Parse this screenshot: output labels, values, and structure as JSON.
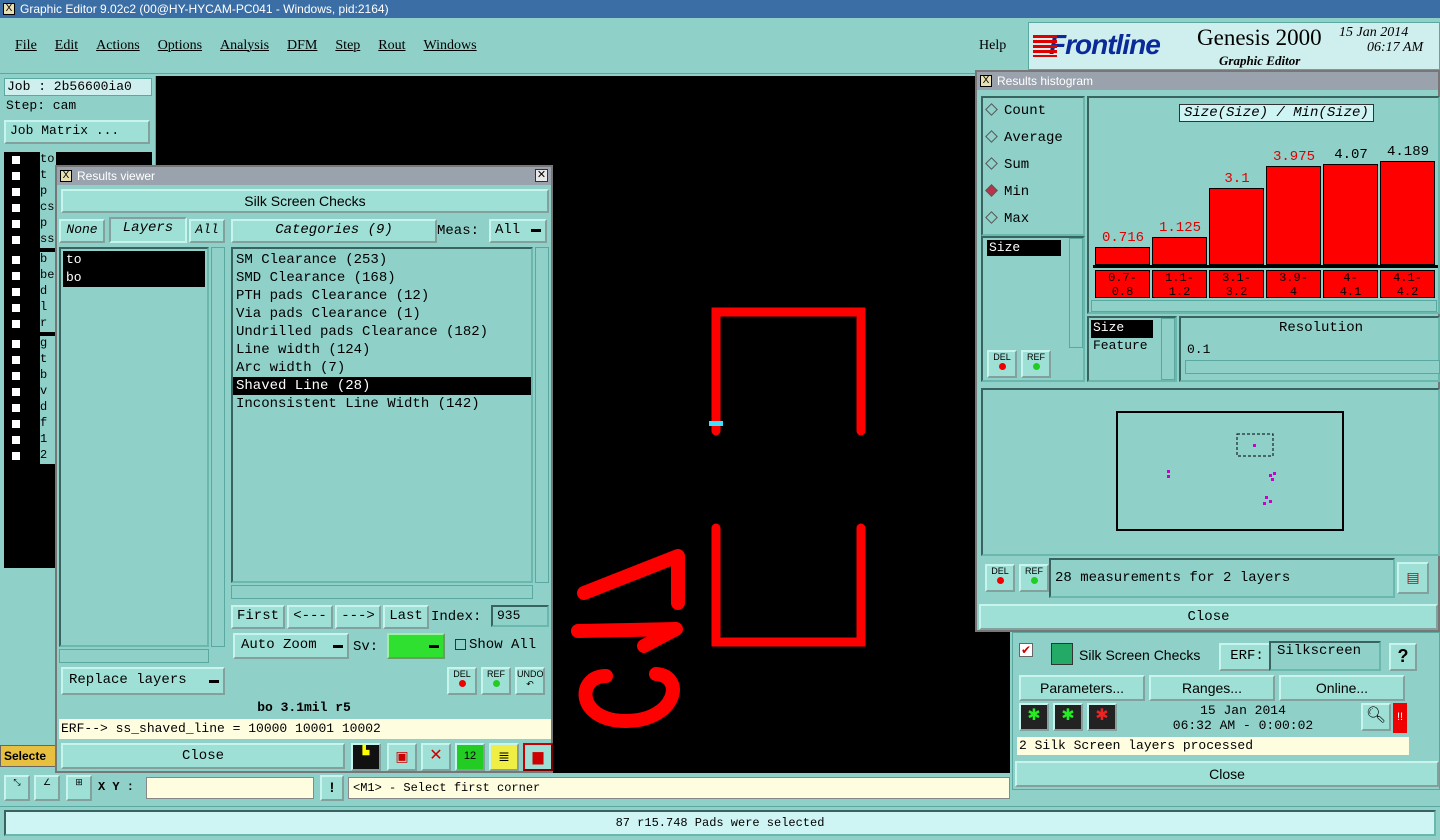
{
  "window": {
    "title": "Graphic Editor 9.02c2 (00@HY-HYCAM-PC041 - Windows, pid:2164)"
  },
  "menu": [
    "File",
    "Edit",
    "Actions",
    "Options",
    "Analysis",
    "DFM",
    "Step",
    "Rout",
    "Windows"
  ],
  "help": "Help",
  "brand": {
    "logo": "Frontline",
    "product": "Genesis 2000",
    "subtitle": "Graphic Editor",
    "date": "15 Jan 2014",
    "time": "06:17 AM"
  },
  "job": {
    "job": "Job : 2b56600ia0",
    "step": "Step: cam",
    "matrix": "Job Matrix ..."
  },
  "layers_left": [
    "to",
    "t",
    "p",
    "cs",
    "p",
    "ss",
    "b",
    "be",
    "d",
    "l",
    "r",
    "g",
    "t",
    "b",
    "v",
    "d",
    "f",
    "1",
    "2"
  ],
  "select_label": "Selecte",
  "xy": {
    "label": "X Y :",
    "prompt": "<M1> - Select first corner"
  },
  "status": "87 r15.748 Pads were selected",
  "results_viewer": {
    "title": "Results viewer",
    "header": "Silk Screen Checks",
    "none_btn": "None",
    "layers_btn": "Layers",
    "all_btn": "All",
    "layers": [
      "to",
      "bo"
    ],
    "categories_btn": "Categories (9)",
    "meas_label": "Meas:",
    "meas_value": "All",
    "categories": [
      "SM Clearance (253)",
      "SMD Clearance (168)",
      "PTH pads Clearance (12)",
      "Via pads Clearance (1)",
      "Undrilled pads Clearance (182)",
      "Line width (124)",
      "Arc width (7)",
      "Shaved Line (28)",
      "Inconsistent Line Width (142)"
    ],
    "selected_category": 7,
    "first": "First",
    "prev": "<---",
    "next": "--->",
    "last": "Last",
    "index_label": "Index:",
    "index_value": "935",
    "auto_zoom": "Auto Zoom",
    "sv_label": "Sv:",
    "show_all": "Show All",
    "replace_layers": "Replace layers",
    "del": "DEL",
    "ref": "REF",
    "undo": "UNDO",
    "info": "bo 3.1mil  r5",
    "erf": "ERF--> ss_shaved_line = 10000 10001 10002",
    "close": "Close"
  },
  "histogram": {
    "title": "Results histogram",
    "modes": [
      "Count",
      "Average",
      "Sum",
      "Min",
      "Max"
    ],
    "selected_mode": 3,
    "chart_title": "Size(Size) / Min(Size)",
    "list_item": "Size",
    "axis_items": [
      "Size",
      "Feature"
    ],
    "resolution_label": "Resolution",
    "resolution_value": "0.1",
    "del": "DEL",
    "ref": "REF",
    "measurements": "28 measurements for 2 layers",
    "close": "Close"
  },
  "chart_data": {
    "type": "bar",
    "title": "Size(Size) / Min(Size)",
    "categories": [
      "0.7-0.8",
      "1.1-1.2",
      "3.1-3.2",
      "3.9-4",
      "4-4.1",
      "4.1-4.2"
    ],
    "values": [
      0.716,
      1.125,
      3.1,
      3.975,
      4.07,
      4.189
    ],
    "value_labels": [
      "0.716",
      "1.125",
      "3.1",
      "3.975",
      "4.07",
      "4.189"
    ],
    "label_colors": [
      "#e00000",
      "#e00000",
      "#e00000",
      "#e00000",
      "#000000",
      "#000000"
    ],
    "bin_lines": [
      [
        "0.7-",
        "0.8"
      ],
      [
        "1.1-",
        "1.2"
      ],
      [
        "3.1-",
        "3.2"
      ],
      [
        "3.9-",
        "4"
      ],
      [
        "4-",
        "4.1"
      ],
      [
        "4.1-",
        "4.2"
      ]
    ],
    "ylim": [
      0,
      4.189
    ],
    "bar_color": "#ff0000"
  },
  "silk": {
    "title": "Silk Screen Checks",
    "erf_label": "ERF:",
    "erf_value": "Silkscreen",
    "help": "?",
    "parameters": "Parameters...",
    "ranges": "Ranges...",
    "online": "Online...",
    "date": "15 Jan 2014",
    "time": "06:32 AM - 0:00:02",
    "processed": "2 Silk Screen layers processed",
    "close": "Close"
  },
  "colors": {
    "accent": "#3a6ea5",
    "teal": "#8fd0c8",
    "feature": "#ff0000",
    "canvas": "#000000"
  }
}
